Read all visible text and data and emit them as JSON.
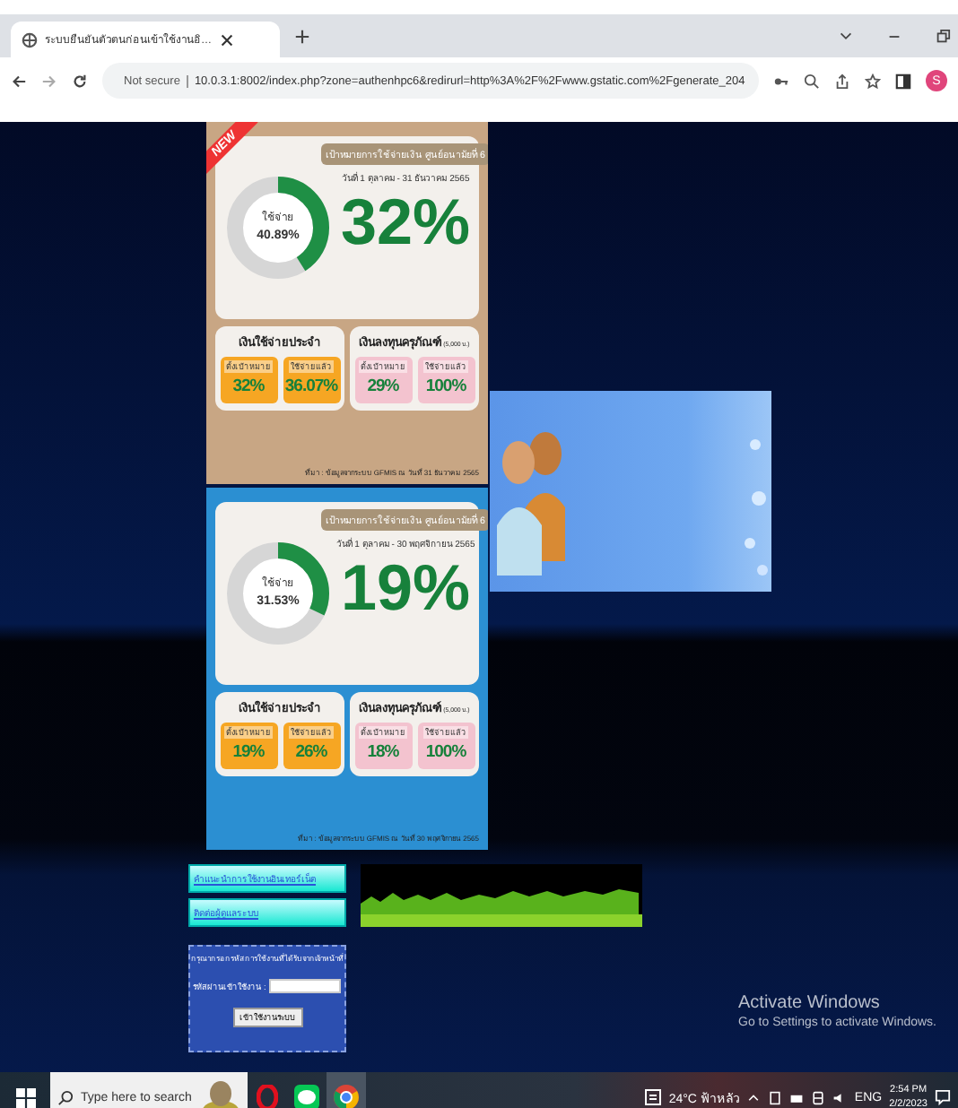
{
  "browser": {
    "tabs": [
      {
        "title": "ระบบยืนยันตัวตนก่อนเข้าใช้งานอิ…",
        "selected": true
      }
    ],
    "address": {
      "security": "Not secure",
      "url": "10.0.3.1:8002/index.php?zone=authenhpc6&redirurl=http%3A%2F%2Fwww.gstatic.com%2Fgenerate_204"
    },
    "profile": "S"
  },
  "infographics": [
    {
      "color": "#c8a684",
      "badge": "NEW",
      "donut_label": "ใช้จ่าย",
      "donut_value": "40.89%",
      "level": 0.41,
      "heading": "เป้าหมายการใช้จ่ายเงิน ศูนย์อนามัยที่ 6",
      "period": "วันที่ 1 ตุลาคม - 31 ธันวาคม 2565",
      "percent": "32%",
      "groups": [
        {
          "title": "เงินใช้จ่ายประจำ",
          "color": "#f6a623",
          "tiles": [
            {
              "label": "ตั้งเป้าหมาย",
              "value": "32%"
            },
            {
              "label": "ใช้จ่ายแล้ว",
              "value": "36.07%"
            }
          ]
        },
        {
          "title": "เงินลงทุนครุภัณฑ์",
          "note": "(5,000 บ.)",
          "color": "#f3c3cf",
          "tiles": [
            {
              "label": "ตั้งเป้าหมาย",
              "value": "29%"
            },
            {
              "label": "ใช้จ่ายแล้ว",
              "value": "100%"
            }
          ]
        }
      ],
      "source": "ที่มา : ข้อมูลจากระบบ GFMIS ณ วันที่ 31 ธันวาคม 2565"
    },
    {
      "color": "#2b8fd2",
      "donut_label": "ใช้จ่าย",
      "donut_value": "31.53%",
      "level": 0.32,
      "heading": "เป้าหมายการใช้จ่ายเงิน ศูนย์อนามัยที่ 6",
      "period": "วันที่ 1 ตุลาคม - 30 พฤศจิกายน 2565",
      "percent": "19%",
      "groups": [
        {
          "title": "เงินใช้จ่ายประจำ",
          "color": "#f6a623",
          "tiles": [
            {
              "label": "ตั้งเป้าหมาย",
              "value": "19%"
            },
            {
              "label": "ใช้จ่ายแล้ว",
              "value": "26%"
            }
          ]
        },
        {
          "title": "เงินลงทุนครุภัณฑ์",
          "note": "(5,000 บ.)",
          "color": "#f3c3cf",
          "tiles": [
            {
              "label": "ตั้งเป้าหมาย",
              "value": "18%"
            },
            {
              "label": "ใช้จ่ายแล้ว",
              "value": "100%"
            }
          ]
        }
      ],
      "source": "ที่มา : ข้อมูลจากระบบ GFMIS ณ วันที่ 30 พฤศจิกายน 2565"
    }
  ],
  "links": [
    "คำแนะนำการใช้งานอินเทอร์เน็ต",
    "ติดต่อผู้ดูแลระบบ"
  ],
  "login": {
    "instruction": "กรุณากรอกรหัสการใช้งานที่ได้รับจากเจ้าหน้าที่",
    "field_label": "รหัสผ่านเข้าใช้งาน :",
    "button": "เข้าใช้งานระบบ"
  },
  "activation": {
    "title": "Activate Windows",
    "message": "Go to Settings to activate Windows."
  },
  "taskbar": {
    "search_placeholder": "Type here to search",
    "weather": "24°C ฟ้าหลัว",
    "language": "ENG",
    "time": "2:54 PM",
    "date": "2/2/2023"
  }
}
